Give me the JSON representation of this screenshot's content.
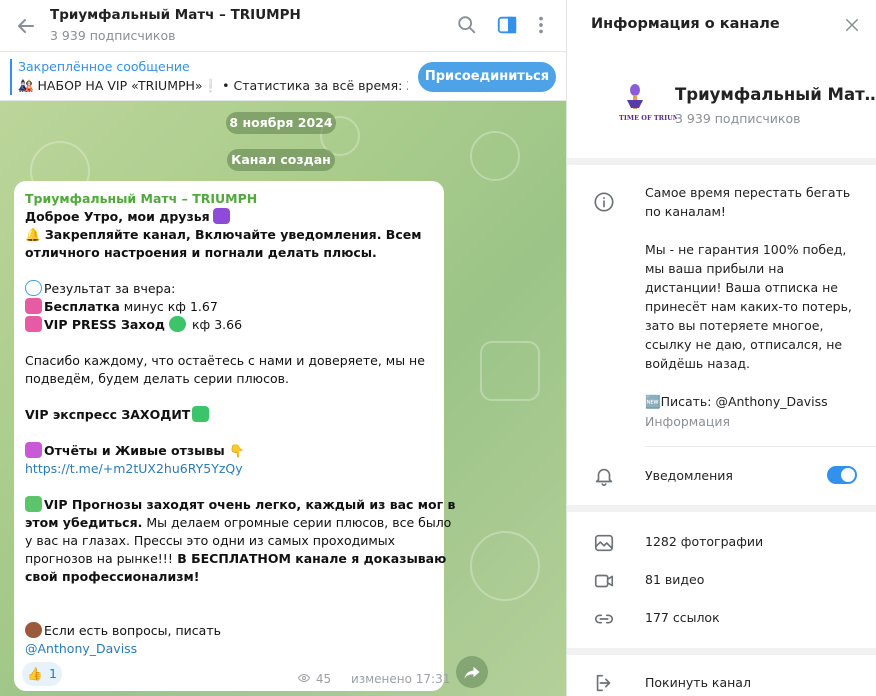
{
  "header": {
    "title": "Триумфальный Матч – TRIUMPH",
    "subscribers": "3 939 подписчиков"
  },
  "pinned": {
    "title": "Закреплённое сообщение",
    "text": "🎎 НАБОР НА VIP «TRIUMPH»❕    • Статистика за всё время: 3…",
    "join_label": "Присоединиться"
  },
  "dates": {
    "date": "8 ноября 2024",
    "created": "Канал создан"
  },
  "message": {
    "author": "Триумфальный Матч – TRIUMPH",
    "l1": "Доброе Утро, мои друзья",
    "l2": "🔔 Закрепляйте канал, Включайте уведомления. Всем",
    "l3": "отличного настроения и погнали делать плюсы.",
    "l4": "Результат за вчера:",
    "l5a": "Бесплатка",
    "l5b": " минус кф 1.67",
    "l6a": "VIP PRESS Заход",
    "l6b": " кф 3.66",
    "l7": "Спасибо каждому, что остаётесь с нами  и доверяете, мы не",
    "l8": "подведём, будем делать серии плюсов.",
    "l9": "VIP экспресс ЗАХОДИТ",
    "l10": "Отчёты и Живые отзывы 👇",
    "l11": "https://t.me/+m2tUX2hu6RY5YzQy",
    "l12": "VIP Прогнозы заходят очень легко, каждый из вас мог в",
    "l13a": "этом убедиться.",
    "l13b": " Мы делаем огромные серии плюсов, все было",
    "l14": "у вас на глазах. Прессы это одни из самых проходимых",
    "l15a": "прогнозов на рынке!!!",
    "l15b": " В БЕСПЛАТНОМ канале я доказываю",
    "l16": "свой профессионализм!",
    "l17": "Если есть вопросы, писать",
    "l18": "@Anthony_Daviss",
    "reaction_emoji": "👍",
    "reaction_count": "1",
    "views": "45",
    "edited": "изменено 17:31"
  },
  "panel": {
    "title": "Информация о канале",
    "name": "Триумфальный Мат…",
    "subscribers": "3 939 подписчиков",
    "logo_text": "TIME OF TRIUMPH",
    "description": [
      "Самое время перестать бегать",
      "по каналам!",
      "",
      "Мы - не гарантия 100% побед,",
      "мы ваша прибыли на",
      "дистанции! Ваша отписка не",
      "принесёт нам каких-то потерь,",
      "зато вы потеряете  многое,",
      "ссылку не даю, отписался, не",
      "войдёшь назад.",
      "",
      "🆕Писать: @Anthony_Daviss"
    ],
    "info_label": "Информация",
    "notifications": "Уведомления",
    "notifications_on": true,
    "photos": "1282 фотографии",
    "videos": "81 видео",
    "links": "177 ссылок",
    "leave": "Покинуть канал"
  },
  "colors": {
    "accent": "#3390ec",
    "author": "#4faa3a",
    "chat_bg": "#a9cc8c"
  },
  "icons": [
    "back-arrow-icon",
    "search-icon",
    "sidebar-toggle-icon",
    "more-vert-icon",
    "close-icon",
    "info-icon",
    "bell-icon",
    "photo-icon",
    "video-icon",
    "link-icon",
    "leave-icon",
    "forward-icon",
    "eye-icon"
  ]
}
